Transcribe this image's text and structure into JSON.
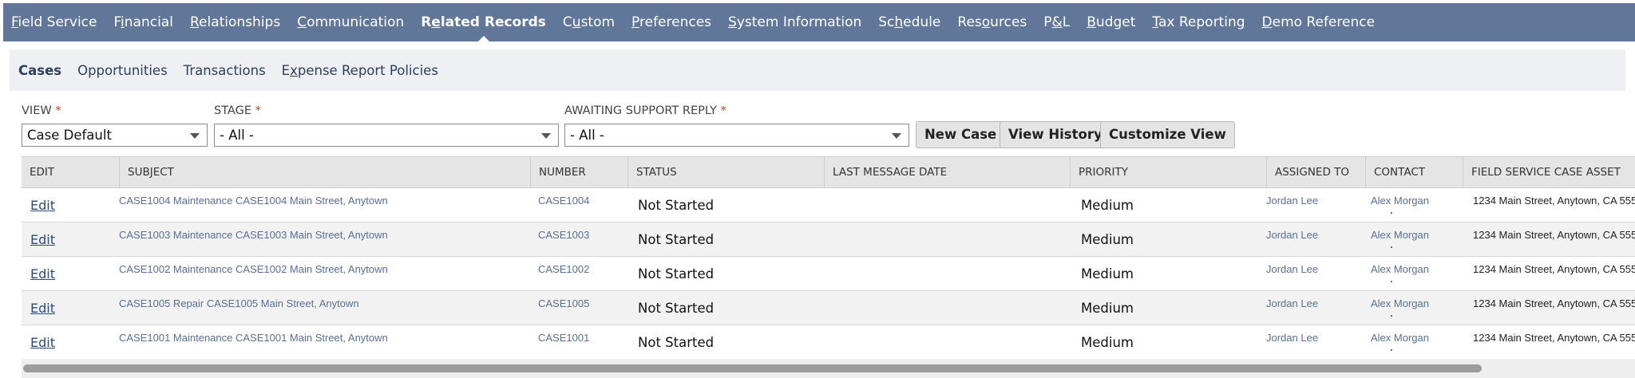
{
  "top_tabs": [
    {
      "pre": "",
      "u": "F",
      "post": "ield Service"
    },
    {
      "pre": "F",
      "u": "i",
      "post": "nancial"
    },
    {
      "pre": "",
      "u": "R",
      "post": "elationships"
    },
    {
      "pre": "",
      "u": "C",
      "post": "ommunication"
    },
    {
      "pre": "R",
      "u": "e",
      "post": "lated Records"
    },
    {
      "pre": "C",
      "u": "u",
      "post": "stom"
    },
    {
      "pre": "",
      "u": "P",
      "post": "references"
    },
    {
      "pre": "",
      "u": "S",
      "post": "ystem Information"
    },
    {
      "pre": "Sc",
      "u": "h",
      "post": "edule"
    },
    {
      "pre": "Res",
      "u": "o",
      "post": "urces"
    },
    {
      "pre": "P",
      "u": "&",
      "post": "L"
    },
    {
      "pre": "",
      "u": "B",
      "post": "udget"
    },
    {
      "pre": "",
      "u": "T",
      "post": "ax Reporting"
    },
    {
      "pre": "",
      "u": "D",
      "post": "emo Reference"
    }
  ],
  "sub_tabs": [
    {
      "pre": "Cases",
      "u": "",
      "post": ""
    },
    {
      "pre": "Opportunities",
      "u": "",
      "post": ""
    },
    {
      "pre": "Transactions",
      "u": "",
      "post": ""
    },
    {
      "pre": "E",
      "u": "x",
      "post": "pense Report Policies"
    }
  ],
  "filters": {
    "view_label": "VIEW",
    "view_value": "Case Default",
    "stage_label": "STAGE",
    "stage_value": "- All -",
    "awaiting_label": "AWAITING SUPPORT REPLY",
    "awaiting_value": "- All -",
    "required_mark": "*"
  },
  "buttons": {
    "new_case": "New Case",
    "view_history": "View History",
    "customize_view": "Customize View"
  },
  "table": {
    "headers": {
      "edit": "EDIT",
      "subject": "SUBJECT",
      "number": "NUMBER",
      "status": "STATUS",
      "last_message_date": "LAST MESSAGE DATE",
      "priority": "PRIORITY",
      "assigned_to": "ASSIGNED TO",
      "contact": "CONTACT",
      "asset": "FIELD SERVICE CASE ASSET"
    },
    "rows": [
      {
        "edit": "Edit",
        "subject": "CASE1004 Maintenance CASE1004 Main Street, Anytown",
        "number": "CASE1004",
        "status": "Not Started",
        "last_message_date": "",
        "priority": "Medium",
        "assigned_to": "Jordan Lee",
        "contact": "Alex Morgan",
        "asset": "1234 Main Street, Anytown, CA 555"
      },
      {
        "edit": "Edit",
        "subject": "CASE1003 Maintenance CASE1003 Main Street, Anytown",
        "number": "CASE1003",
        "status": "Not Started",
        "last_message_date": "",
        "priority": "Medium",
        "assigned_to": "Jordan Lee",
        "contact": "Alex Morgan",
        "asset": "1234 Main Street, Anytown, CA 555"
      },
      {
        "edit": "Edit",
        "subject": "CASE1002 Maintenance CASE1002 Main Street, Anytown",
        "number": "CASE1002",
        "status": "Not Started",
        "last_message_date": "",
        "priority": "Medium",
        "assigned_to": "Jordan Lee",
        "contact": "Alex Morgan",
        "asset": "1234 Main Street, Anytown, CA 555"
      },
      {
        "edit": "Edit",
        "subject": "CASE1005 Repair CASE1005 Main Street, Anytown",
        "number": "CASE1005",
        "status": "Not Started",
        "last_message_date": "",
        "priority": "Medium",
        "assigned_to": "Jordan Lee",
        "contact": "Alex Morgan",
        "asset": "1234 Main Street, Anytown, CA 555"
      },
      {
        "edit": "Edit",
        "subject": "CASE1001 Maintenance CASE1001 Main Street, Anytown",
        "number": "CASE1001",
        "status": "Not Started",
        "last_message_date": "",
        "priority": "Medium",
        "assigned_to": "Jordan Lee",
        "contact": "Alex Morgan",
        "asset": "1234 Main Street, Anytown, CA 555"
      }
    ]
  },
  "colors": {
    "nav_bg": "#607799",
    "subnav_bg": "#eef0f4",
    "link": "#5a6f95",
    "required": "#c8410a"
  }
}
